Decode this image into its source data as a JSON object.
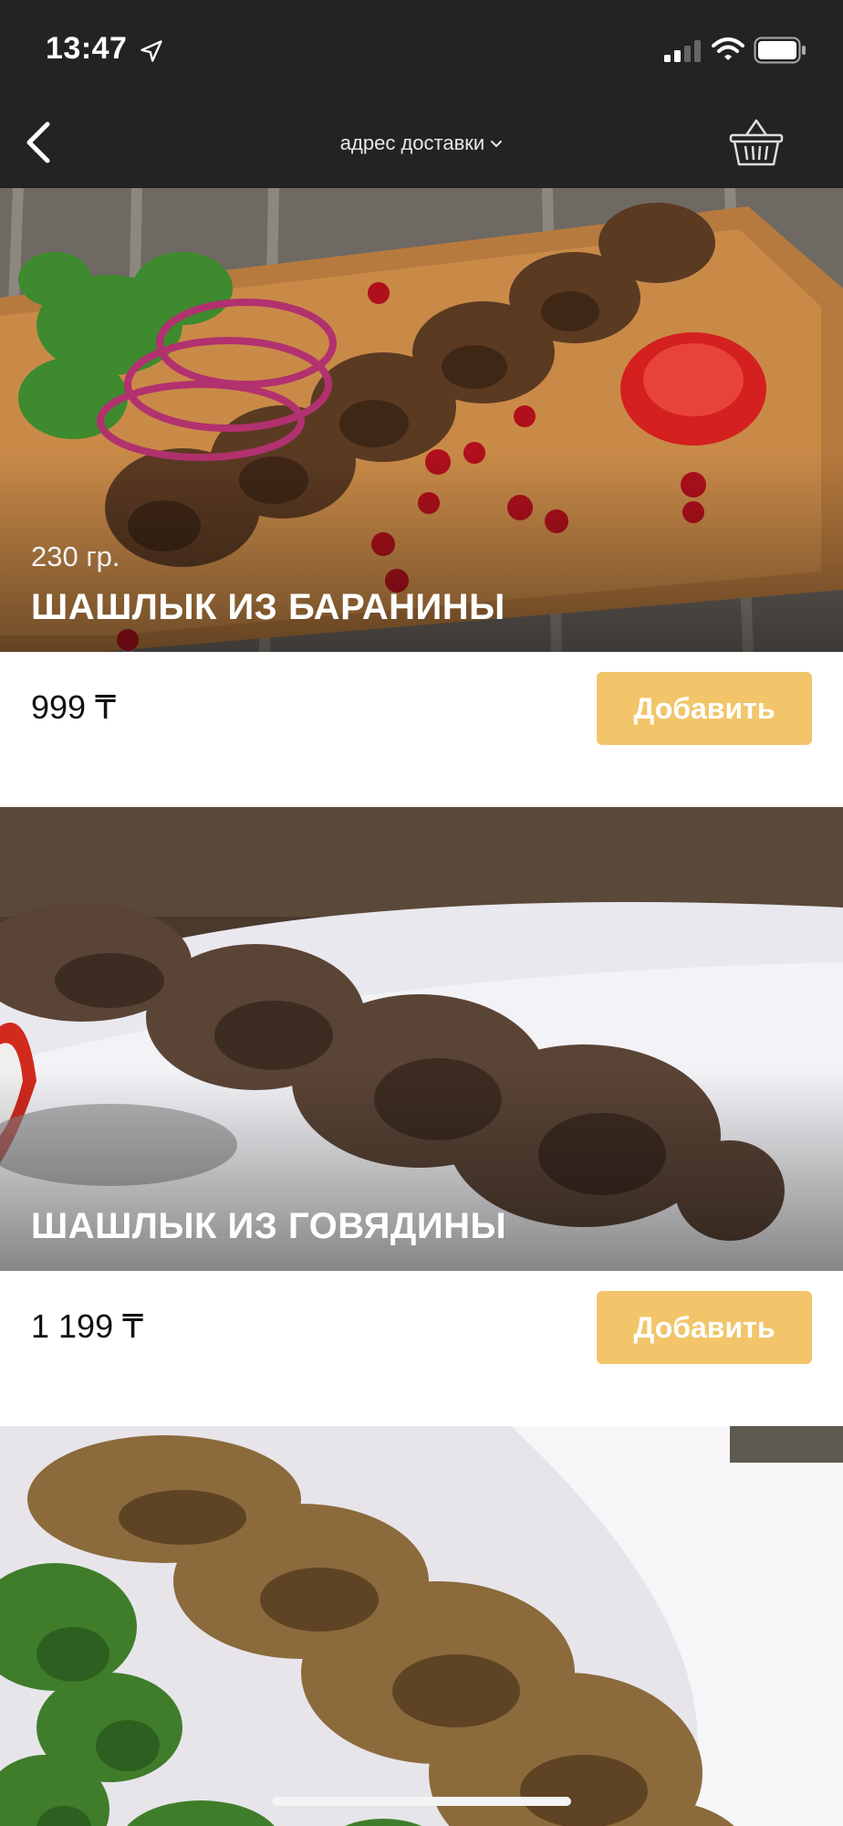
{
  "status_bar": {
    "time": "13:47"
  },
  "nav": {
    "title": "адрес доставки",
    "back_icon": "chevron-left-icon",
    "cart_icon": "basket-icon"
  },
  "products": [
    {
      "weight": "230 гр.",
      "name": "ШАШЛЫК ИЗ БАРАНИНЫ",
      "price": "999 ₸",
      "add_label": "Добавить"
    },
    {
      "weight": "",
      "name": "ШАШЛЫК ИЗ ГОВЯДИНЫ",
      "price": "1 199 ₸",
      "add_label": "Добавить"
    },
    {
      "weight": "",
      "name": "",
      "price": "",
      "add_label": ""
    }
  ],
  "colors": {
    "header_bg": "#232323",
    "accent": "#f2c56a"
  }
}
